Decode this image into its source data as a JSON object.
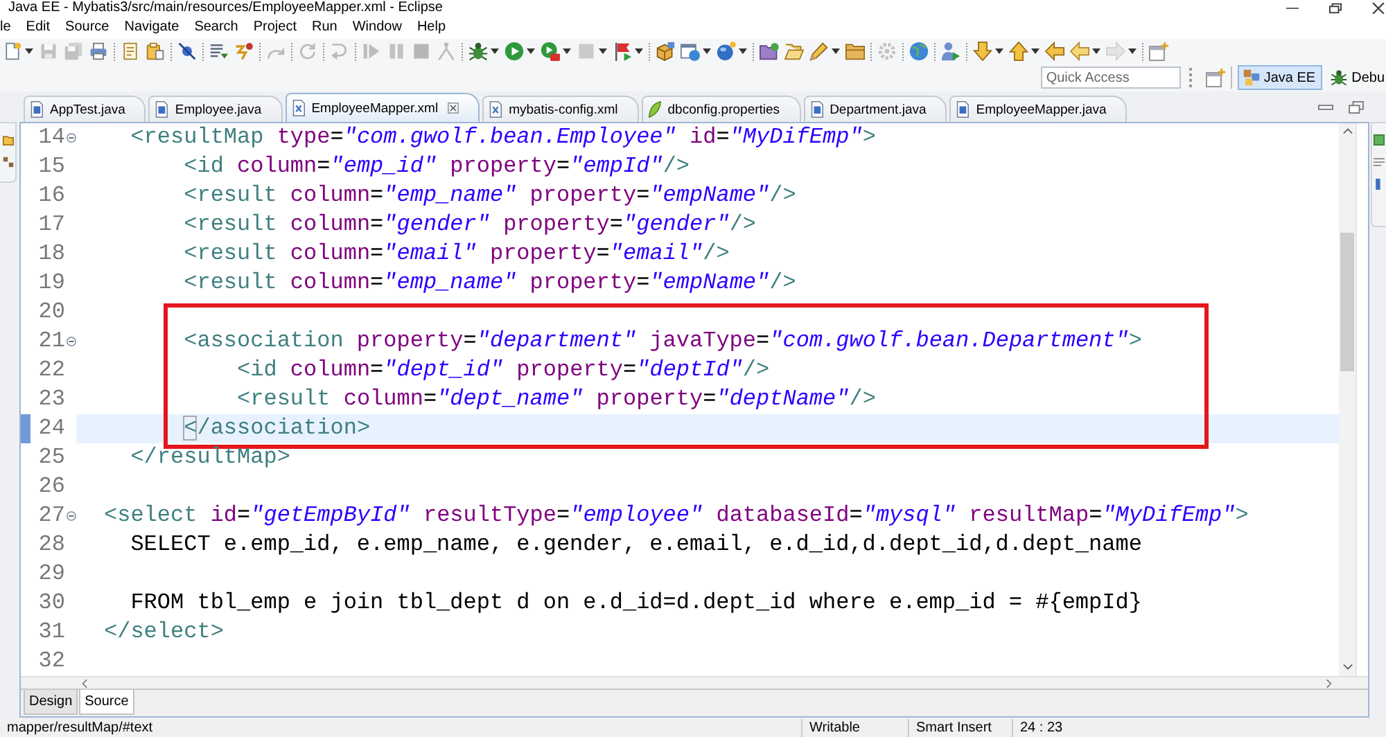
{
  "window": {
    "title": "Java EE - Mybatis3/src/main/resources/EmployeeMapper.xml - Eclipse"
  },
  "menu": [
    "le",
    "Edit",
    "Source",
    "Navigate",
    "Search",
    "Project",
    "Run",
    "Window",
    "Help"
  ],
  "toolbar": [
    {
      "buttons": [
        {
          "disabled": false,
          "dropdown": true
        },
        {
          "disabled": true,
          "dropdown": false
        },
        {
          "disabled": true,
          "dropdown": false
        },
        {
          "disabled": false,
          "dropdown": false
        }
      ]
    },
    {
      "buttons": [
        {
          "disabled": false,
          "dropdown": false
        },
        {
          "disabled": false,
          "dropdown": false
        }
      ]
    },
    {
      "buttons": [
        {
          "disabled": false,
          "dropdown": false
        }
      ]
    },
    {
      "buttons": [
        {
          "disabled": false,
          "dropdown": false
        },
        {
          "disabled": false,
          "dropdown": false
        }
      ]
    },
    {
      "buttons": [
        {
          "disabled": true,
          "dropdown": false
        }
      ]
    },
    {
      "buttons": [
        {
          "disabled": true,
          "dropdown": false
        }
      ]
    },
    {
      "buttons": [
        {
          "disabled": true,
          "dropdown": false
        }
      ]
    },
    {
      "buttons": [
        {
          "disabled": true,
          "dropdown": false
        },
        {
          "disabled": true,
          "dropdown": false
        },
        {
          "disabled": true,
          "dropdown": false
        },
        {
          "disabled": true,
          "dropdown": false
        }
      ]
    },
    {
      "buttons": [
        {
          "disabled": false,
          "dropdown": true
        },
        {
          "disabled": false,
          "dropdown": true
        },
        {
          "disabled": false,
          "dropdown": true
        },
        {
          "disabled": true,
          "dropdown": true
        },
        {
          "disabled": false,
          "dropdown": true
        }
      ]
    },
    {
      "buttons": [
        {
          "disabled": false,
          "dropdown": false
        },
        {
          "disabled": false,
          "dropdown": true
        },
        {
          "disabled": false,
          "dropdown": true
        }
      ]
    },
    {
      "buttons": [
        {
          "disabled": false,
          "dropdown": false
        },
        {
          "disabled": false,
          "dropdown": false
        },
        {
          "disabled": false,
          "dropdown": true
        },
        {
          "disabled": false,
          "dropdown": false
        }
      ]
    },
    {
      "buttons": [
        {
          "disabled": true,
          "dropdown": false
        }
      ]
    },
    {
      "buttons": [
        {
          "disabled": false,
          "dropdown": false
        }
      ]
    },
    {
      "buttons": [
        {
          "disabled": false,
          "dropdown": false
        }
      ]
    },
    {
      "buttons": [
        {
          "disabled": false,
          "dropdown": true
        },
        {
          "disabled": false,
          "dropdown": true
        },
        {
          "disabled": false,
          "dropdown": false
        },
        {
          "disabled": false,
          "dropdown": true
        },
        {
          "disabled": true,
          "dropdown": true
        }
      ]
    },
    {
      "buttons": [
        {
          "disabled": false,
          "dropdown": false
        }
      ]
    }
  ],
  "quick_access": {
    "placeholder": "Quick Access"
  },
  "perspectives": [
    {
      "label": "Java EE",
      "selected": true
    },
    {
      "label": "Debu",
      "selected": false
    }
  ],
  "tabs": [
    {
      "label": "AppTest.java",
      "kind": "java",
      "selected": false
    },
    {
      "label": "Employee.java",
      "kind": "java",
      "selected": false
    },
    {
      "label": "EmployeeMapper.xml",
      "kind": "xml",
      "selected": true
    },
    {
      "label": "mybatis-config.xml",
      "kind": "xml",
      "selected": false
    },
    {
      "label": "dbconfig.properties",
      "kind": "properties",
      "selected": false
    },
    {
      "label": "Department.java",
      "kind": "java",
      "selected": false
    },
    {
      "label": "EmployeeMapper.java",
      "kind": "java",
      "selected": false
    }
  ],
  "editor": {
    "blocks": [
      {
        "highlighted": false,
        "lines": [
          {
            "number": "14",
            "fold": true,
            "current": false,
            "changed": false,
            "tokens": [
              {
                "kind": "tag",
                "text": "  <resultMap"
              },
              {
                "kind": "attr",
                "text": " type"
              },
              {
                "kind": "text",
                "text": "="
              },
              {
                "kind": "value",
                "text": "\"com.gwolf.bean.Employee\""
              },
              {
                "kind": "attr",
                "text": " id"
              },
              {
                "kind": "text",
                "text": "="
              },
              {
                "kind": "value",
                "text": "\"MyDifEmp\""
              },
              {
                "kind": "tag",
                "text": ">"
              }
            ]
          },
          {
            "number": "15",
            "fold": false,
            "current": false,
            "changed": false,
            "tokens": [
              {
                "kind": "tag",
                "text": "      <id"
              },
              {
                "kind": "attr",
                "text": " column"
              },
              {
                "kind": "text",
                "text": "="
              },
              {
                "kind": "value",
                "text": "\"emp_id\""
              },
              {
                "kind": "attr",
                "text": " property"
              },
              {
                "kind": "text",
                "text": "="
              },
              {
                "kind": "value",
                "text": "\"empId\""
              },
              {
                "kind": "tag",
                "text": "/>"
              }
            ]
          },
          {
            "number": "16",
            "fold": false,
            "current": false,
            "changed": false,
            "tokens": [
              {
                "kind": "tag",
                "text": "      <result"
              },
              {
                "kind": "attr",
                "text": " column"
              },
              {
                "kind": "text",
                "text": "="
              },
              {
                "kind": "value",
                "text": "\"emp_name\""
              },
              {
                "kind": "attr",
                "text": " property"
              },
              {
                "kind": "text",
                "text": "="
              },
              {
                "kind": "value",
                "text": "\"empName\""
              },
              {
                "kind": "tag",
                "text": "/>"
              }
            ]
          },
          {
            "number": "17",
            "fold": false,
            "current": false,
            "changed": false,
            "tokens": [
              {
                "kind": "tag",
                "text": "      <result"
              },
              {
                "kind": "attr",
                "text": " column"
              },
              {
                "kind": "text",
                "text": "="
              },
              {
                "kind": "value",
                "text": "\"gender\""
              },
              {
                "kind": "attr",
                "text": " property"
              },
              {
                "kind": "text",
                "text": "="
              },
              {
                "kind": "value",
                "text": "\"gender\""
              },
              {
                "kind": "tag",
                "text": "/>"
              }
            ]
          },
          {
            "number": "18",
            "fold": false,
            "current": false,
            "changed": false,
            "tokens": [
              {
                "kind": "tag",
                "text": "      <result"
              },
              {
                "kind": "attr",
                "text": " column"
              },
              {
                "kind": "text",
                "text": "="
              },
              {
                "kind": "value",
                "text": "\"email\""
              },
              {
                "kind": "attr",
                "text": " property"
              },
              {
                "kind": "text",
                "text": "="
              },
              {
                "kind": "value",
                "text": "\"email\""
              },
              {
                "kind": "tag",
                "text": "/>"
              }
            ]
          },
          {
            "number": "19",
            "fold": false,
            "current": false,
            "changed": false,
            "tokens": [
              {
                "kind": "tag",
                "text": "      <result"
              },
              {
                "kind": "attr",
                "text": " column"
              },
              {
                "kind": "text",
                "text": "="
              },
              {
                "kind": "value",
                "text": "\"emp_name\""
              },
              {
                "kind": "attr",
                "text": " property"
              },
              {
                "kind": "text",
                "text": "="
              },
              {
                "kind": "value",
                "text": "\"empName\""
              },
              {
                "kind": "tag",
                "text": "/>"
              }
            ]
          }
        ]
      },
      {
        "highlighted": true,
        "lines": [
          {
            "number": "20",
            "fold": false,
            "current": false,
            "changed": false
          },
          {
            "number": "21",
            "fold": true,
            "current": false,
            "changed": false,
            "tokens": [
              {
                "kind": "tag",
                "text": "      <association"
              },
              {
                "kind": "attr",
                "text": " property"
              },
              {
                "kind": "text",
                "text": "="
              },
              {
                "kind": "value",
                "text": "\"department\""
              },
              {
                "kind": "attr",
                "text": " javaType"
              },
              {
                "kind": "text",
                "text": "="
              },
              {
                "kind": "value",
                "text": "\"com.gwolf.bean.Department\""
              },
              {
                "kind": "tag",
                "text": ">"
              }
            ]
          },
          {
            "number": "22",
            "fold": false,
            "current": false,
            "changed": false,
            "tokens": [
              {
                "kind": "tag",
                "text": "          <id"
              },
              {
                "kind": "attr",
                "text": " column"
              },
              {
                "kind": "text",
                "text": "="
              },
              {
                "kind": "value",
                "text": "\"dept_id\""
              },
              {
                "kind": "attr",
                "text": " property"
              },
              {
                "kind": "text",
                "text": "="
              },
              {
                "kind": "value",
                "text": "\"deptId\""
              },
              {
                "kind": "tag",
                "text": "/>"
              }
            ]
          },
          {
            "number": "23",
            "fold": false,
            "current": false,
            "changed": false,
            "tokens": [
              {
                "kind": "tag",
                "text": "          <result"
              },
              {
                "kind": "attr",
                "text": " column"
              },
              {
                "kind": "text",
                "text": "="
              },
              {
                "kind": "value",
                "text": "\"dept_name\""
              },
              {
                "kind": "attr",
                "text": " property"
              },
              {
                "kind": "text",
                "text": "="
              },
              {
                "kind": "value",
                "text": "\"deptName\""
              },
              {
                "kind": "tag",
                "text": "/>"
              }
            ]
          },
          {
            "number": "24",
            "fold": false,
            "current": true,
            "changed": true,
            "tokens": [
              {
                "kind": "tag",
                "text": "      <",
                "boxed": true
              },
              {
                "kind": "tag",
                "text": "/association>"
              }
            ]
          }
        ]
      },
      {
        "highlighted": false,
        "lines": [
          {
            "number": "25",
            "fold": false,
            "current": false,
            "changed": false,
            "tokens": [
              {
                "kind": "tag",
                "text": "  </resultMap>"
              }
            ]
          },
          {
            "number": "26",
            "fold": false,
            "current": false,
            "changed": false
          },
          {
            "number": "27",
            "fold": true,
            "current": false,
            "changed": false,
            "tokens": [
              {
                "kind": "tag",
                "text": "<select"
              },
              {
                "kind": "attr",
                "text": " id"
              },
              {
                "kind": "text",
                "text": "="
              },
              {
                "kind": "value",
                "text": "\"getEmpById\""
              },
              {
                "kind": "attr",
                "text": " resultType"
              },
              {
                "kind": "text",
                "text": "="
              },
              {
                "kind": "value",
                "text": "\"employee\""
              },
              {
                "kind": "attr",
                "text": " databaseId"
              },
              {
                "kind": "text",
                "text": "="
              },
              {
                "kind": "value",
                "text": "\"mysql\""
              },
              {
                "kind": "attr",
                "text": " resultMap"
              },
              {
                "kind": "text",
                "text": "="
              },
              {
                "kind": "value",
                "text": "\"MyDifEmp\""
              },
              {
                "kind": "tag",
                "text": ">"
              }
            ]
          },
          {
            "number": "28",
            "fold": false,
            "current": false,
            "changed": false,
            "tokens": [
              {
                "kind": "text",
                "text": "  SELECT e.emp_id, e.emp_name, e.gender, e.email, e.d_id,d.dept_id,d.dept_name"
              }
            ]
          },
          {
            "number": "29",
            "fold": false,
            "current": false,
            "changed": false
          },
          {
            "number": "30",
            "fold": false,
            "current": false,
            "changed": false,
            "tokens": [
              {
                "kind": "text",
                "text": "  FROM tbl_emp e join tbl_dept d on e.d_id=d.dept_id where e.emp_id = #{empId}"
              }
            ]
          },
          {
            "number": "31",
            "fold": false,
            "current": false,
            "changed": false,
            "tokens": [
              {
                "kind": "tag",
                "text": "</select>"
              }
            ]
          },
          {
            "number": "32",
            "fold": false,
            "current": false,
            "changed": false
          }
        ]
      }
    ]
  },
  "bottom_tabs": [
    {
      "label": "Design",
      "selected": false
    },
    {
      "label": "Source",
      "selected": true
    }
  ],
  "status_bar": {
    "path": "mapper/resultMap/#text",
    "fields": [
      "Writable",
      "Smart Insert",
      "24 : 23"
    ]
  }
}
